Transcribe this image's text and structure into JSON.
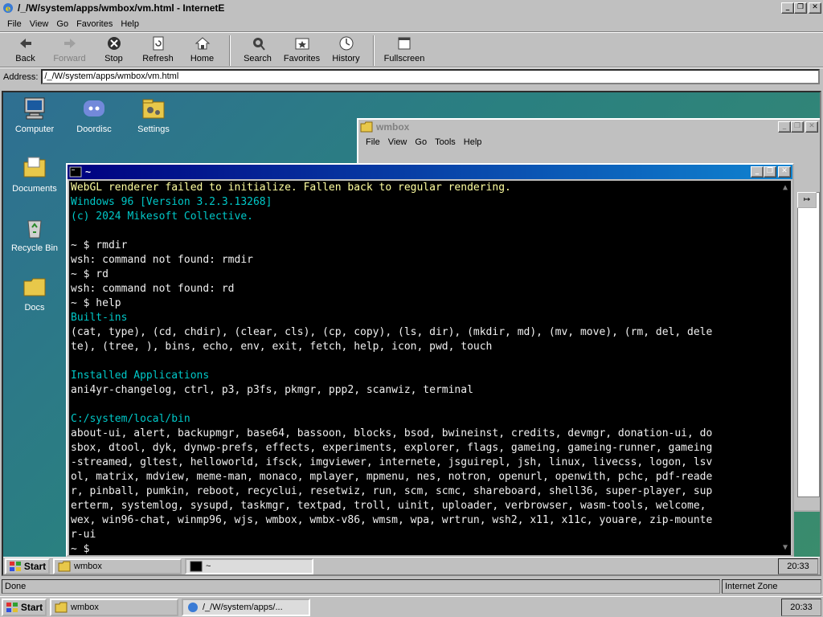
{
  "ie": {
    "title": "/_/W/system/apps/wmbox/vm.html - InternetE",
    "menu": [
      "File",
      "View",
      "Go",
      "Favorites",
      "Help"
    ],
    "toolbar": {
      "back": "Back",
      "forward": "Forward",
      "stop": "Stop",
      "refresh": "Refresh",
      "home": "Home",
      "search": "Search",
      "favorites": "Favorites",
      "history": "History",
      "fullscreen": "Fullscreen"
    },
    "address_label": "Address:",
    "address_value": "/_/W/system/apps/wmbox/vm.html",
    "status_text": "Done",
    "zone_text": "Internet Zone"
  },
  "desktop": {
    "icons": [
      {
        "label": "Computer",
        "icon": "computer-icon"
      },
      {
        "label": "Doordisc",
        "icon": "discord-icon"
      },
      {
        "label": "Settings",
        "icon": "settings-icon"
      },
      {
        "label": "Documents",
        "icon": "folder-icon"
      },
      {
        "label": "Recycle Bin",
        "icon": "recycle-bin-icon"
      },
      {
        "label": "Docs",
        "icon": "folder-icon"
      }
    ]
  },
  "wmbox": {
    "title": "wmbox",
    "menu": [
      "File",
      "View",
      "Go",
      "Tools",
      "Help"
    ]
  },
  "terminal": {
    "title": "~",
    "lines": [
      {
        "text": "WebGL renderer failed to initialize. Fallen back to regular rendering.",
        "color": "yellow"
      },
      {
        "text": "Windows 96 [Version 3.2.3.13268]",
        "color": "cyan"
      },
      {
        "text": "(c) 2024 Mikesoft Collective.",
        "color": "cyan"
      },
      {
        "text": "",
        "color": "white"
      },
      {
        "text": "~ $ rmdir",
        "color": "white"
      },
      {
        "text": "wsh: command not found: rmdir",
        "color": "white"
      },
      {
        "text": "~ $ rd",
        "color": "white"
      },
      {
        "text": "wsh: command not found: rd",
        "color": "white"
      },
      {
        "text": "~ $ help",
        "color": "white"
      },
      {
        "text": "Built-ins",
        "color": "cyan"
      },
      {
        "text": "(cat, type), (cd, chdir), (clear, cls), (cp, copy), (ls, dir), (mkdir, md), (mv, move), (rm, del, dele",
        "color": "white"
      },
      {
        "text": "te), (tree, ), bins, echo, env, exit, fetch, help, icon, pwd, touch",
        "color": "white"
      },
      {
        "text": "",
        "color": "white"
      },
      {
        "text": "Installed Applications",
        "color": "cyan"
      },
      {
        "text": "ani4yr-changelog, ctrl, p3, p3fs, pkmgr, ppp2, scanwiz, terminal",
        "color": "white"
      },
      {
        "text": "",
        "color": "white"
      },
      {
        "text": "C:/system/local/bin",
        "color": "cyan"
      },
      {
        "text": "about-ui, alert, backupmgr, base64, bassoon, blocks, bsod, bwineinst, credits, devmgr, donation-ui, do",
        "color": "white"
      },
      {
        "text": "sbox, dtool, dyk, dynwp-prefs, effects, experiments, explorer, flags, gameing, gameing-runner, gameing",
        "color": "white"
      },
      {
        "text": "-streamed, gltest, helloworld, ifsck, imgviewer, internete, jsguirepl, jsh, linux, livecss, logon, lsv",
        "color": "white"
      },
      {
        "text": "ol, matrix, mdview, meme-man, monaco, mplayer, mpmenu, nes, notron, openurl, openwith, pchc, pdf-reade",
        "color": "white"
      },
      {
        "text": "r, pinball, pumkin, reboot, recyclui, resetwiz, run, scm, scmc, shareboard, shell36, super-player, sup",
        "color": "white"
      },
      {
        "text": "erterm, systemlog, sysupd, taskmgr, textpad, troll, uinit, uploader, verbrowser, wasm-tools, welcome,",
        "color": "white"
      },
      {
        "text": "wex, win96-chat, winmp96, wjs, wmbox, wmbx-v86, wmsm, wpa, wrtrun, wsh2, x11, x11c, youare, zip-mounte",
        "color": "white"
      },
      {
        "text": "r-ui",
        "color": "white"
      },
      {
        "text": "~ $",
        "color": "white"
      }
    ]
  },
  "inner_taskbar": {
    "start": "Start",
    "tasks": [
      {
        "label": "wmbox",
        "active": false
      },
      {
        "label": "~",
        "active": true
      }
    ],
    "clock": "20:33"
  },
  "host_taskbar": {
    "start": "Start",
    "tasks": [
      {
        "label": "wmbox",
        "active": false
      },
      {
        "label": "/_/W/system/apps/...",
        "active": true
      }
    ],
    "clock": "20:33"
  }
}
